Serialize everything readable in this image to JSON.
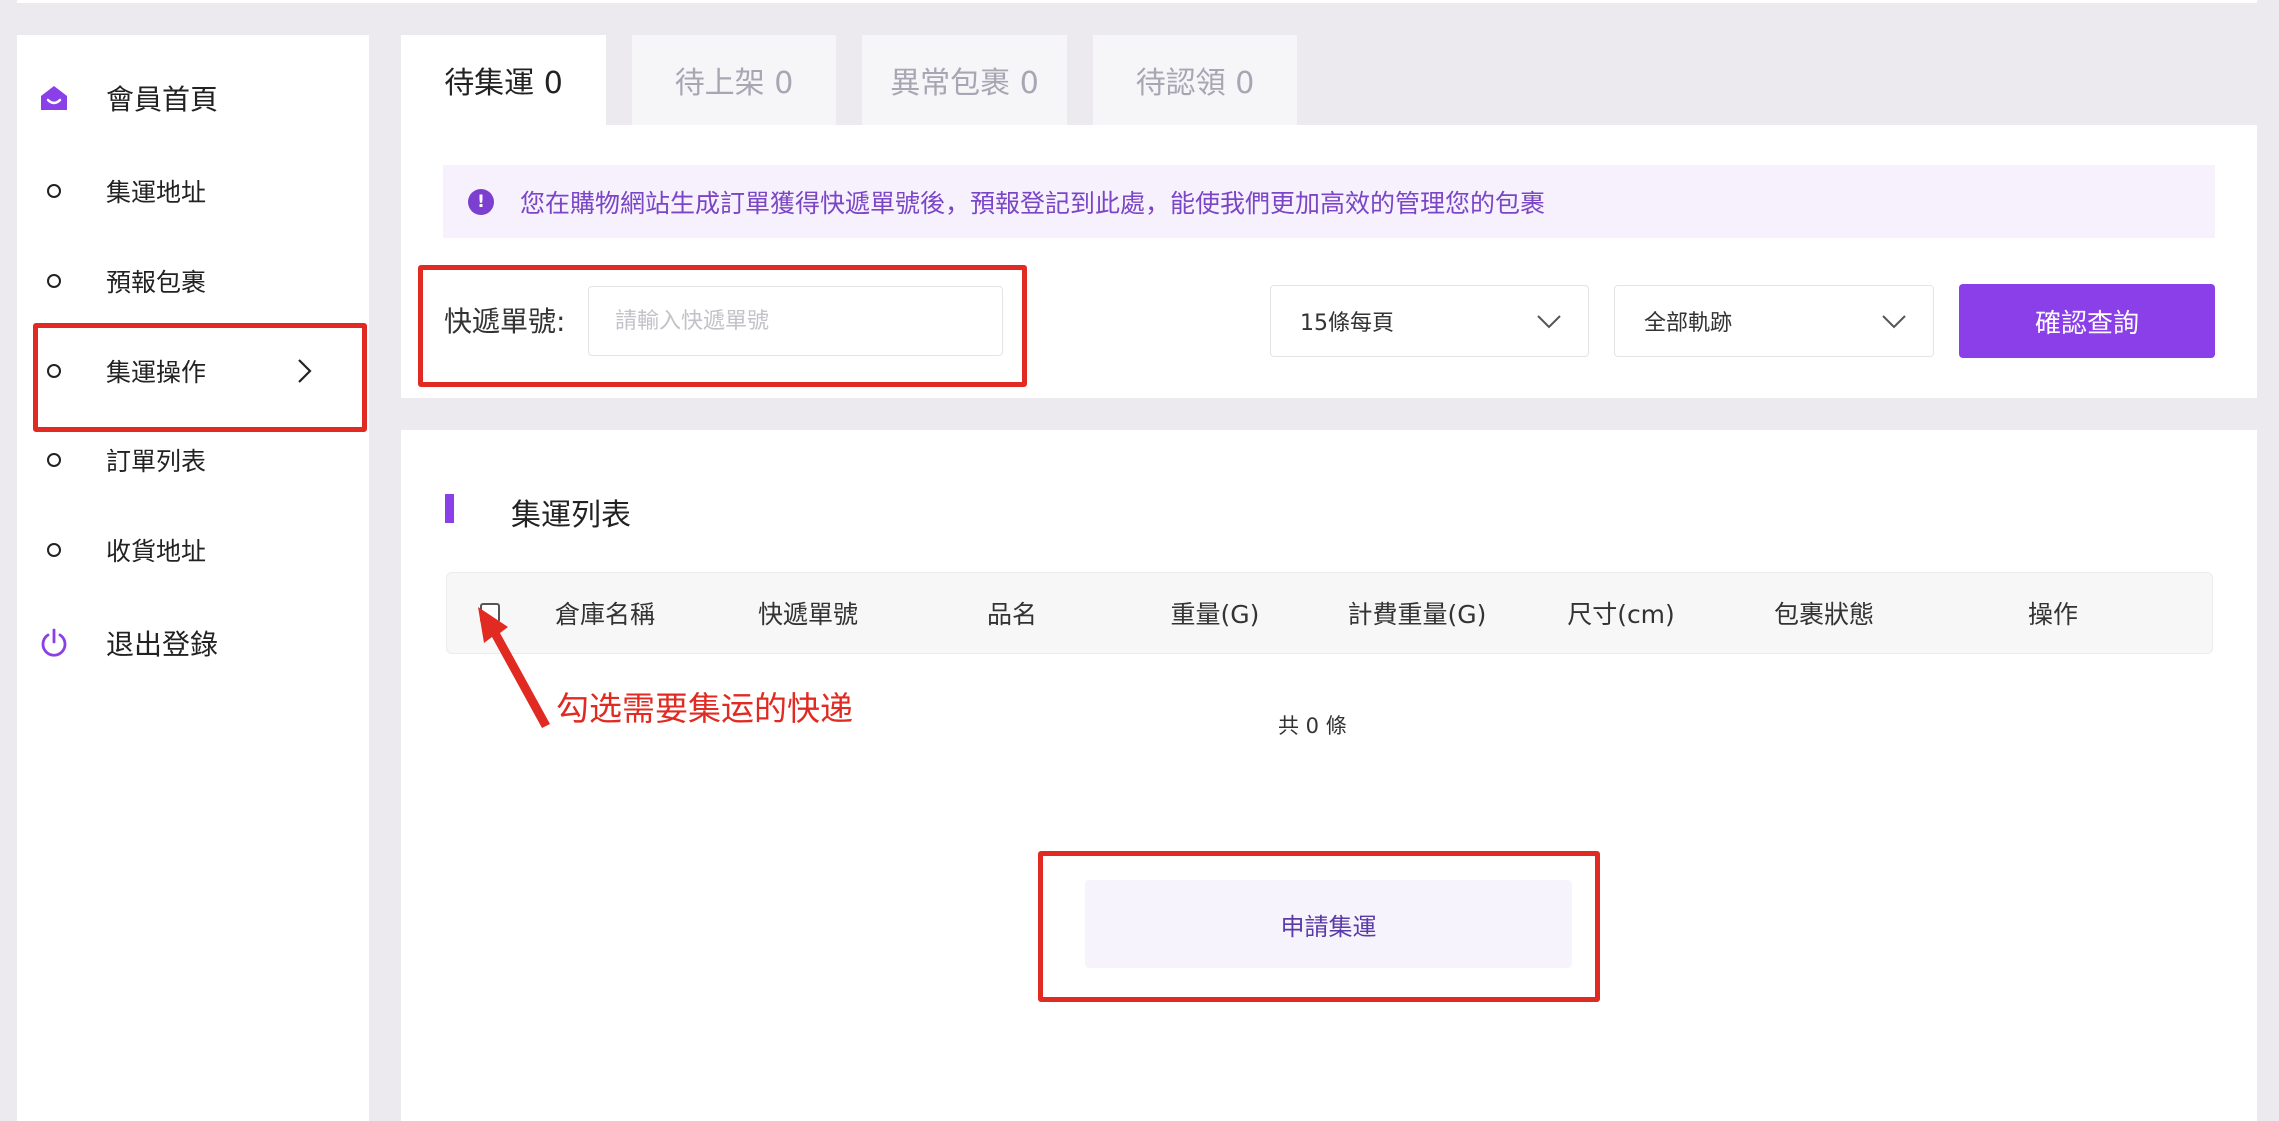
{
  "sidebar": {
    "items": [
      {
        "label": "會員首頁",
        "icon": "home-icon"
      },
      {
        "label": "集運地址",
        "icon": "circle-bullet-icon"
      },
      {
        "label": "預報包裹",
        "icon": "circle-bullet-icon"
      },
      {
        "label": "集運操作",
        "icon": "circle-bullet-icon"
      },
      {
        "label": "訂單列表",
        "icon": "circle-bullet-icon"
      },
      {
        "label": "收貨地址",
        "icon": "circle-bullet-icon"
      },
      {
        "label": "退出登錄",
        "icon": "power-icon"
      }
    ]
  },
  "tabs": [
    {
      "label": "待集運 0",
      "active": true
    },
    {
      "label": "待上架 0",
      "active": false
    },
    {
      "label": "異常包裹 0",
      "active": false
    },
    {
      "label": "待認領 0",
      "active": false
    }
  ],
  "notice": {
    "text": "您在購物網站生成訂單獲得快遞單號後，預報登記到此處，能使我們更加高效的管理您的包裹"
  },
  "search": {
    "label": "快遞單號:",
    "placeholder": "請輸入快遞單號",
    "page_size": "15條每頁",
    "track_filter": "全部軌跡",
    "submit_label": "確認查詢"
  },
  "list": {
    "title": "集運列表",
    "columns": [
      "倉庫名稱",
      "快遞單號",
      "品名",
      "重量(G)",
      "計費重量(G)",
      "尺寸(cm)",
      "包裹狀態",
      "操作"
    ],
    "rows": [],
    "total": "共 0 條",
    "apply_label": "申請集運"
  },
  "annotation": {
    "text": "勾选需要集运的快递"
  },
  "colors": {
    "accent": "#8a3fe8",
    "annotation_red": "#e12b22",
    "notice_bg": "#f6f1fd"
  }
}
